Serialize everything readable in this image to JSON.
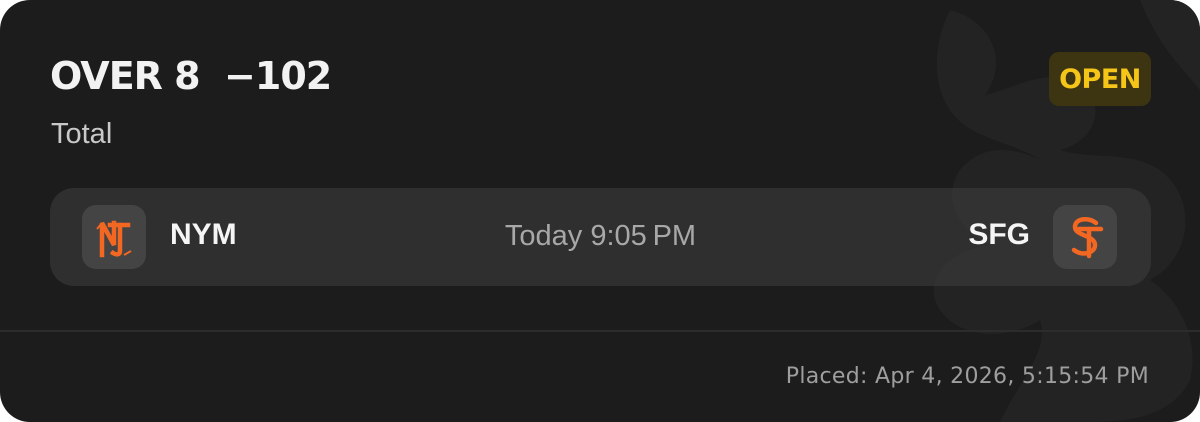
{
  "bet": {
    "title": "OVER 8  −102",
    "type": "Total",
    "status": "OPEN"
  },
  "matchup": {
    "away_team": {
      "abbr": "NYM",
      "logo_icon": "mets-logo-icon"
    },
    "home_team": {
      "abbr": "SFG",
      "logo_icon": "giants-logo-icon"
    },
    "game_time": "Today 9:05 PM"
  },
  "footer": {
    "placed": "Placed: Apr 4, 2026, 5:15:54 PM"
  },
  "colors": {
    "card_bg": "#1c1c1c",
    "status_text": "#f5c518",
    "status_bg": "#3d3412",
    "team_logo_orange": "#f26722"
  }
}
